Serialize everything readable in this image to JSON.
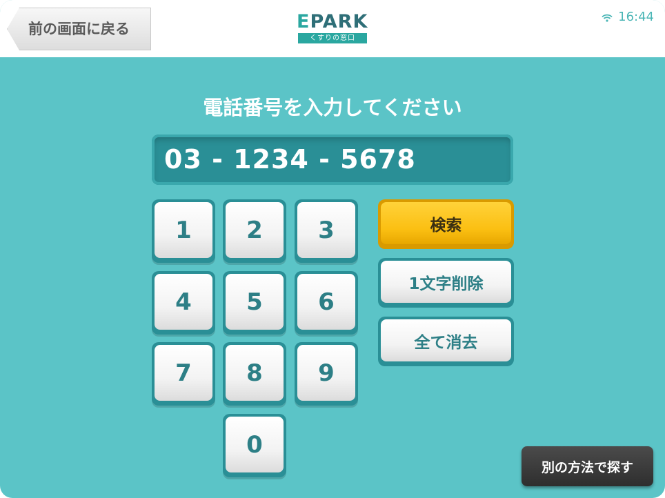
{
  "header": {
    "back_label": "前の画面に戻る",
    "logo_text_e": "E",
    "logo_text_park": "PARK",
    "logo_sub": "くすりの窓口",
    "wifi_icon": "wifi-icon",
    "time": "16:44"
  },
  "main": {
    "prompt": "電話番号を入力してください",
    "phone_value": "03 - 1234 - 5678"
  },
  "keypad": {
    "k1": "1",
    "k2": "2",
    "k3": "3",
    "k4": "4",
    "k5": "5",
    "k6": "6",
    "k7": "7",
    "k8": "8",
    "k9": "9",
    "k0": "0"
  },
  "actions": {
    "search": "検索",
    "delete_one": "1文字削除",
    "clear_all": "全て消去"
  },
  "footer": {
    "alt_method": "別の方法で探す"
  },
  "colors": {
    "background": "#5bc4c7",
    "field": "#2a8f96",
    "search_button": "#fbbf12",
    "key_text": "#2d7f86",
    "alt_button": "#3a3a3a"
  }
}
